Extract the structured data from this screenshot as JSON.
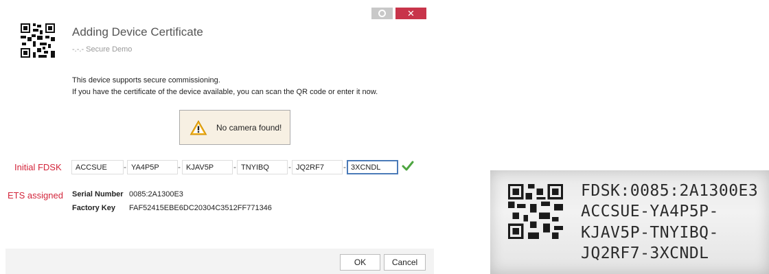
{
  "dialog": {
    "title": "Adding Device Certificate",
    "subtitle": "-.-.- Secure Demo",
    "message_line1": "This device supports secure commissioning.",
    "message_line2": "If you have the certificate of the device available, you can scan the QR code or enter it now.",
    "warning": {
      "icon": "warning-triangle-icon",
      "text": "No camera found!",
      "background_color": "#f7f0e3"
    },
    "window_buttons": {
      "settings_icon": "gear-icon",
      "close_symbol": "✕",
      "close_color": "#c8344a"
    },
    "initial_fdsk": {
      "label": "Initial FDSK",
      "segments": [
        "ACCSUE",
        "YA4P5P",
        "KJAV5P",
        "TNYIBQ",
        "JQ2RF7",
        "3XCNDL"
      ],
      "separator": "-",
      "valid_icon": "checkmark-icon",
      "label_color": "#d3243a"
    },
    "ets_assigned": {
      "label": "ETS assigned",
      "serial_number_label": "Serial Number",
      "serial_number_value": "0085:2A1300E3",
      "factory_key_label": "Factory Key",
      "factory_key_value": "FAF52415EBE6DC20304C3512FF771346"
    },
    "footer": {
      "ok_label": "OK",
      "cancel_label": "Cancel"
    }
  },
  "device_label": {
    "line1": "FDSK:0085:2A1300E3",
    "line2": "ACCSUE-YA4P5P-",
    "line3": "KJAV5P-TNYIBQ-",
    "line4": "JQ2RF7-3XCNDL"
  }
}
